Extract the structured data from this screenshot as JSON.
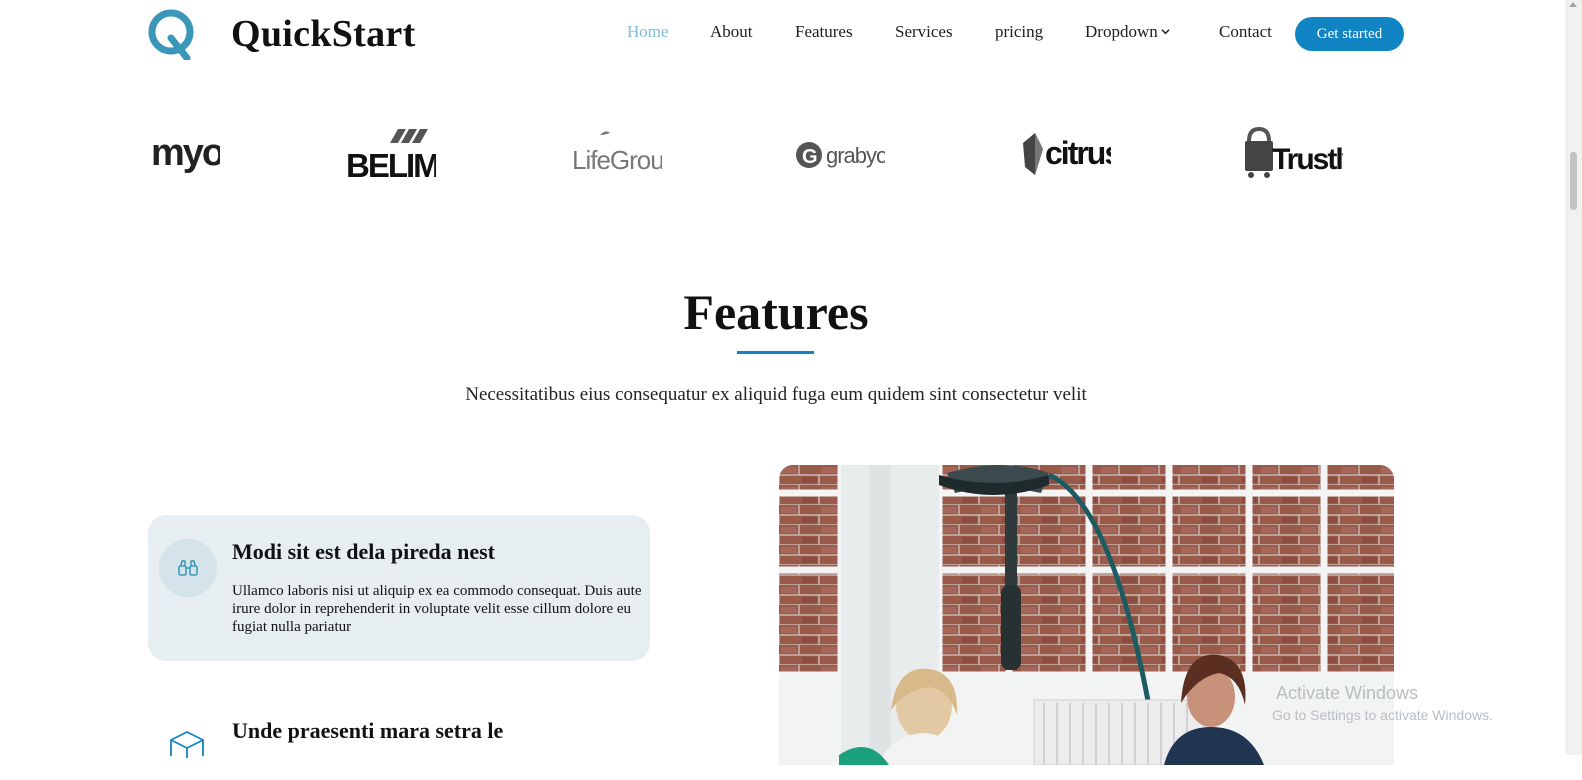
{
  "brand": {
    "name": "QuickStart"
  },
  "nav": {
    "items": [
      {
        "label": "Home",
        "active": true
      },
      {
        "label": "About",
        "active": false
      },
      {
        "label": "Features",
        "active": false
      },
      {
        "label": "Services",
        "active": false
      },
      {
        "label": "pricing",
        "active": false
      },
      {
        "label": "Dropdown",
        "active": false
      },
      {
        "label": "Contact",
        "active": false
      }
    ],
    "cta_label": "Get started"
  },
  "clients": [
    {
      "name": "myob",
      "icon": "myob-logo"
    },
    {
      "name": "BELIMO",
      "icon": "belimo-logo"
    },
    {
      "name": "LifeGroups",
      "icon": "lifegroups-logo"
    },
    {
      "name": "grabyo",
      "icon": "grabyo-logo"
    },
    {
      "name": "citrus",
      "icon": "citrus-logo"
    },
    {
      "name": "Trustly",
      "icon": "trustly-logo"
    }
  ],
  "features_section": {
    "title": "Features",
    "subtitle": "Necessitatibus eius consequatur ex aliquid fuga eum quidem sint consectetur velit",
    "items": [
      {
        "title": "Modi sit est dela pireda nest",
        "text": "Ullamco laboris nisi ut aliquip ex ea commodo consequat. Duis aute irure dolor in reprehenderit in voluptate velit esse cillum dolore eu fugiat nulla pariatur",
        "icon": "binoculars-icon",
        "active": true
      },
      {
        "title": "Unde praesenti mara setra le",
        "icon": "box-icon",
        "active": false
      }
    ]
  },
  "watermark": {
    "line1": "Activate Windows",
    "line2": "Go to Settings to activate Windows."
  },
  "colors": {
    "accent": "#1185c4",
    "active_nav": "#7fbcd8",
    "feature_bg": "#e6eef1"
  }
}
